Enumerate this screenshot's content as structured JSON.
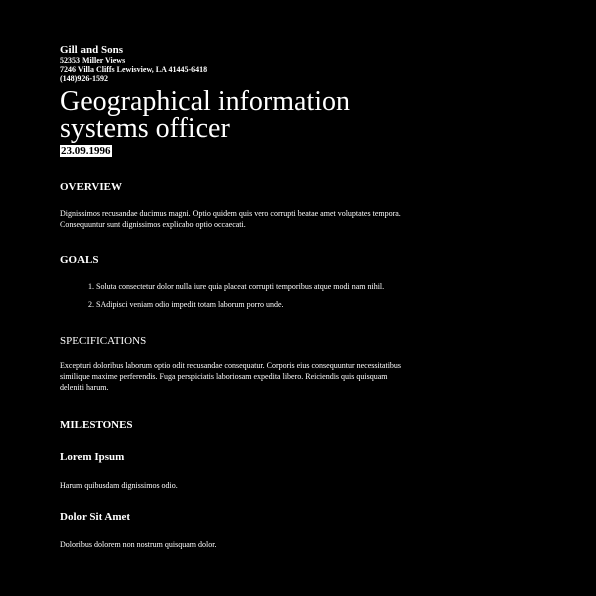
{
  "header": {
    "company": "Gill and Sons",
    "address_line1": "52353 Miller Views",
    "address_line2": "7246 Villa Cliffs Lewisview, LA 41445-6418",
    "phone": "(148)926-1592"
  },
  "title": "Geographical information systems officer",
  "date": "23.09.1996",
  "overview": {
    "heading": "OVERVIEW",
    "text": "Dignissimos recusandae ducimus magni. Optio quidem quis vero corrupti beatae amet voluptates tempora. Consequuntur sunt dignissimos explicabo optio occaecati."
  },
  "goals": {
    "heading": "GOALS",
    "items": [
      "1. Soluta consectetur dolor nulla iure quia placeat corrupti temporibus atque modi nam nihil.",
      "2. SAdipisci veniam odio impedit totam laborum porro unde."
    ]
  },
  "specifications": {
    "heading": "SPECIFICATIONS",
    "text": "Excepturi doloribus laborum optio odit recusandae consequatur. Corporis eius consequuntur necessitatibus similique maxime perferendis. Fuga perspiciatis laboriosam expedita libero. Reiciendis quis quisquam deleniti harum."
  },
  "milestones": {
    "heading": "MILESTONES",
    "items": [
      {
        "title": "Lorem Ipsum",
        "text": "Harum quibusdam dignissimos odio."
      },
      {
        "title": "Dolor Sit Amet",
        "text": "Doloribus dolorem non nostrum quisquam dolor."
      }
    ]
  }
}
